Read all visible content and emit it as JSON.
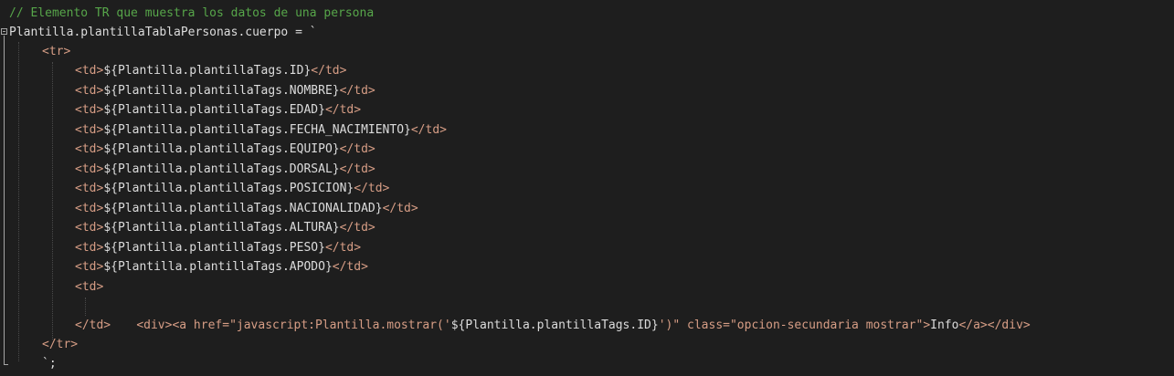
{
  "code": {
    "comment": "// Elemento TR que muestra los datos de una persona",
    "declaration": "Plantilla.plantillaTablaPersonas.cuerpo = `",
    "tr_open": "<tr>",
    "td_rows": [
      {
        "open": "<td>",
        "expr": "${Plantilla.plantillaTags.ID}",
        "close": "</td>"
      },
      {
        "open": "<td>",
        "expr": "${Plantilla.plantillaTags.NOMBRE}",
        "close": "</td>"
      },
      {
        "open": "<td>",
        "expr": "${Plantilla.plantillaTags.EDAD}",
        "close": "</td>"
      },
      {
        "open": "<td>",
        "expr": "${Plantilla.plantillaTags.FECHA_NACIMIENTO}",
        "close": "</td>"
      },
      {
        "open": "<td>",
        "expr": "${Plantilla.plantillaTags.EQUIPO}",
        "close": "</td>"
      },
      {
        "open": "<td>",
        "expr": "${Plantilla.plantillaTags.DORSAL}",
        "close": "</td>"
      },
      {
        "open": "<td>",
        "expr": "${Plantilla.plantillaTags.POSICION}",
        "close": "</td>"
      },
      {
        "open": "<td>",
        "expr": "${Plantilla.plantillaTags.NACIONALIDAD}",
        "close": "</td>"
      },
      {
        "open": "<td>",
        "expr": "${Plantilla.plantillaTags.ALTURA}",
        "close": "</td>"
      },
      {
        "open": "<td>",
        "expr": "${Plantilla.plantillaTags.PESO}",
        "close": "</td>"
      },
      {
        "open": "<td>",
        "expr": "${Plantilla.plantillaTags.APODO}",
        "close": "</td>"
      }
    ],
    "td_open": "<td>",
    "div_line": {
      "div_open": "<div>",
      "a_open_start": "<a href=",
      "href_value": "\"javascript:Plantilla.mostrar('",
      "href_expr": "${Plantilla.plantillaTags.ID}",
      "href_end": "')\"",
      "class_attr": " class=",
      "class_value": "\"opcion-secundaria mostrar\"",
      "a_close_bracket": ">",
      "link_text": "Info",
      "a_close": "</a>",
      "div_close": "</div>"
    },
    "td_close": "</td>",
    "tr_close": "</tr>",
    "terminator": "`;"
  },
  "colors": {
    "background": "#1e1e1e",
    "comment": "#57a64a",
    "tag": "#d69d85",
    "text": "#dcdcdc"
  }
}
